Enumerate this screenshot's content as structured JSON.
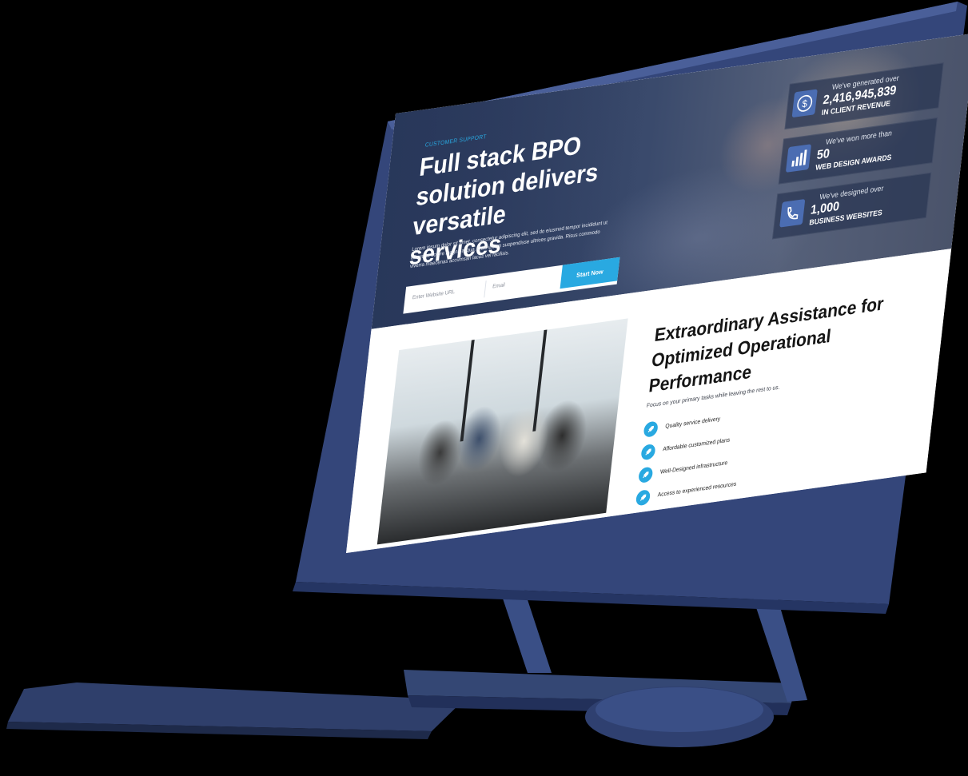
{
  "hero": {
    "eyebrow": "CUSTOMER SUPPORT",
    "title": "Full stack BPO solution delivers versatile services",
    "body": "Lorem ipsum dolor sit amet, consectetur adipiscing elit, sed do eiusmod tempor incididunt ut labore et dolore magna aliqua. Quis ipsum suspendisse ultrices gravida. Risus commodo viverra maecenas accumsan lacus vel facilisis.",
    "form": {
      "url_placeholder": "Enter Website URL",
      "email_placeholder": "Email",
      "submit_label": "Start Now"
    }
  },
  "stats": [
    {
      "caption": "We've generated over",
      "number": "2,416,945,839",
      "label": "IN CLIENT REVENUE",
      "icon": "dollar-icon"
    },
    {
      "caption": "We've won more than",
      "number": "50",
      "label": "WEB DESIGN AWARDS",
      "icon": "bar-chart-icon"
    },
    {
      "caption": "We've designed over",
      "number": "1,000",
      "label": "BUSINESS WEBSITES",
      "icon": "phone-icon"
    }
  ],
  "section": {
    "title": "Extraordinary Assistance for Optimized Operational Performance",
    "subtitle": "Focus on your primary tasks while leaving the rest to us.",
    "features": [
      "Quality service delivery",
      "Affordable customized plans",
      "Well-Designed infrastructure",
      "Access to experienced resources"
    ]
  },
  "colors": {
    "accent": "#29a9e1",
    "hardware": "#2c3c66",
    "hero_overlay": "#2b3a5c"
  }
}
